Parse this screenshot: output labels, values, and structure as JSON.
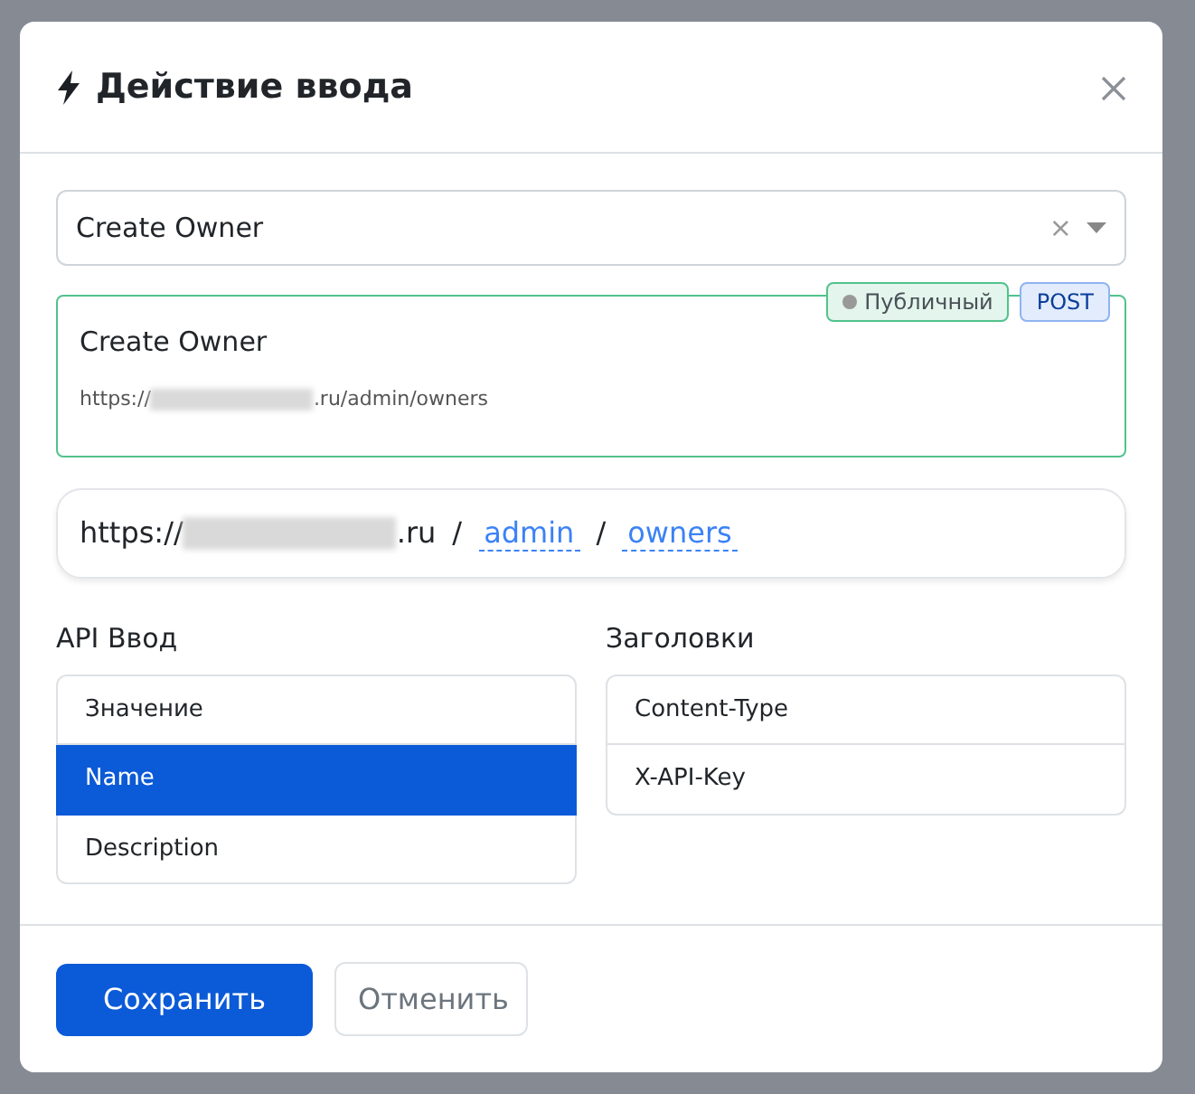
{
  "modal": {
    "title": "Действие ввода"
  },
  "select": {
    "value": "Create Owner",
    "clear": "×"
  },
  "action_card": {
    "name": "Create Owner",
    "url_prefix": "https://",
    "url_suffix": ".ru/admin/owners",
    "visibility": "Публичный",
    "method": "POST"
  },
  "breadcrumb": {
    "base_prefix": "https://",
    "base_suffix": ".ru",
    "separator": "/",
    "segments": [
      {
        "label": "admin"
      },
      {
        "label": "owners"
      }
    ]
  },
  "api_input": {
    "heading": "API Ввод",
    "items": [
      {
        "label": "Значение",
        "selected": false
      },
      {
        "label": "Name",
        "selected": true
      },
      {
        "label": "Description",
        "selected": false
      }
    ]
  },
  "headers": {
    "heading": "Заголовки",
    "items": [
      {
        "label": "Content-Type"
      },
      {
        "label": "X-API-Key"
      }
    ]
  },
  "buttons": [
    {
      "label": "Сохранить",
      "kind": "primary"
    },
    {
      "label": "Отменить",
      "kind": "secondary"
    }
  ]
}
